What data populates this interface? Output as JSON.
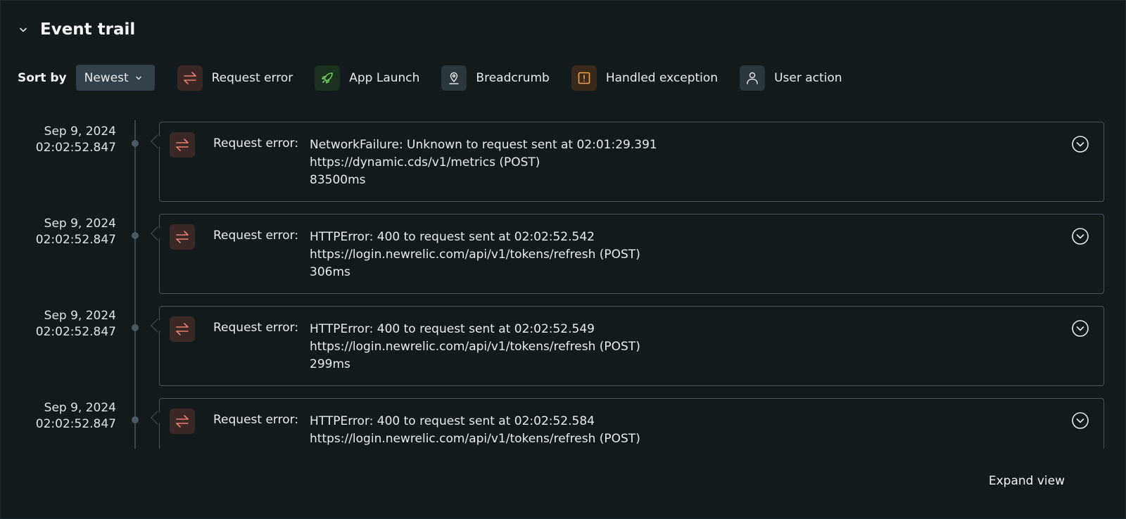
{
  "header": {
    "title": "Event trail"
  },
  "filters": {
    "sort_label": "Sort by",
    "sort_value": "Newest",
    "legend": [
      {
        "label": "Request error",
        "icon": "request-error-icon",
        "color": "#e8806f"
      },
      {
        "label": "App Launch",
        "icon": "rocket-icon",
        "color": "#6fcf5a"
      },
      {
        "label": "Breadcrumb",
        "icon": "location-pin-icon",
        "color": "#dfe4e6"
      },
      {
        "label": "Handled exception",
        "icon": "exclamation-icon",
        "color": "#f0a548"
      },
      {
        "label": "User action",
        "icon": "user-icon",
        "color": "#dfe4e6"
      }
    ]
  },
  "events": [
    {
      "date": "Sep 9, 2024",
      "time": "02:02:52.847",
      "type": "Request error:",
      "line1": "NetworkFailure: Unknown to request sent at 02:01:29.391",
      "line2": "https://dynamic.cds/v1/metrics (POST)",
      "line3": "83500ms"
    },
    {
      "date": "Sep 9, 2024",
      "time": "02:02:52.847",
      "type": "Request error:",
      "line1": "HTTPError: 400 to request sent at 02:02:52.542",
      "line2": "https://login.newrelic.com/api/v1/tokens/refresh (POST)",
      "line3": "306ms"
    },
    {
      "date": "Sep 9, 2024",
      "time": "02:02:52.847",
      "type": "Request error:",
      "line1": "HTTPError: 400 to request sent at 02:02:52.549",
      "line2": "https://login.newrelic.com/api/v1/tokens/refresh (POST)",
      "line3": "299ms"
    },
    {
      "date": "Sep 9, 2024",
      "time": "02:02:52.847",
      "type": "Request error:",
      "line1": "HTTPError: 400 to request sent at 02:02:52.584",
      "line2": "https://login.newrelic.com/api/v1/tokens/refresh (POST)",
      "line3": ""
    }
  ],
  "footer": {
    "expand_label": "Expand view"
  }
}
